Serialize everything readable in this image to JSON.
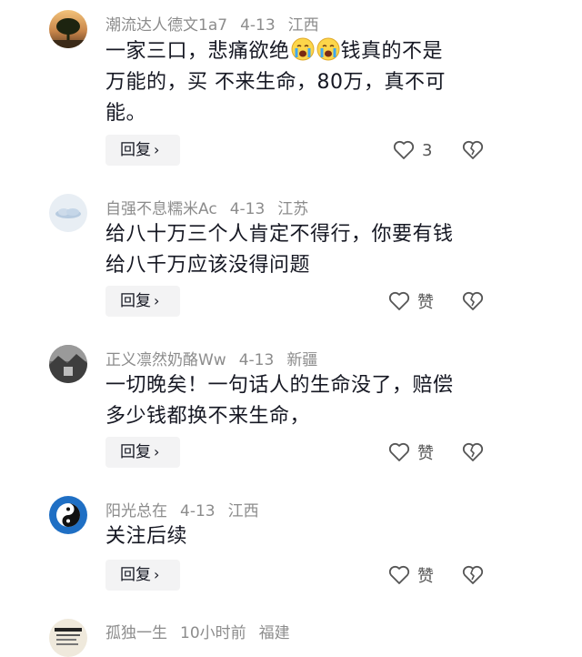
{
  "comments": [
    {
      "username": "潮流达人德文1a7",
      "date": "4-13",
      "location": "江西",
      "text_lines": [
        "一家三口，悲痛欲绝",
        "钱真的不是",
        "万能的，买 不来生命，80万，真不可",
        "能。"
      ],
      "emoji_names": [
        "crying-face-emoji",
        "crying-face-emoji"
      ],
      "reply_label": "回复",
      "like_label": "3",
      "avatar_icon": "tree-sunset-avatar"
    },
    {
      "username": "自强不息糯米Ac",
      "date": "4-13",
      "location": "江苏",
      "text_lines": [
        "给八十万三个人肯定不得行，你要有钱",
        "给八千万应该没得问题"
      ],
      "reply_label": "回复",
      "like_label": "赞",
      "avatar_icon": "cloud-avatar"
    },
    {
      "username": "正义凛然奶酪Ww",
      "date": "4-13",
      "location": "新疆",
      "text_lines": [
        "一切晚矣！一句话人的生命没了，赔偿",
        "多少钱都换不来生命，"
      ],
      "reply_label": "回复",
      "like_label": "赞",
      "avatar_icon": "dark-landscape-avatar"
    },
    {
      "username": "阳光总在",
      "date": "4-13",
      "location": "江西",
      "text_lines": [
        "关注后续"
      ],
      "reply_label": "回复",
      "like_label": "赞",
      "avatar_icon": "yin-yang-avatar"
    },
    {
      "username": "孤独一生",
      "date": "10小时前",
      "location": "福建",
      "avatar_icon": "calligraphy-avatar"
    }
  ],
  "colors": {
    "meta": "#8c8c8c",
    "text": "#161823",
    "reply_bg": "#f3f3f4"
  },
  "icons": {
    "like": "heart-outline-icon",
    "dislike": "broken-heart-icon",
    "chevron": "chevron-right-icon"
  }
}
